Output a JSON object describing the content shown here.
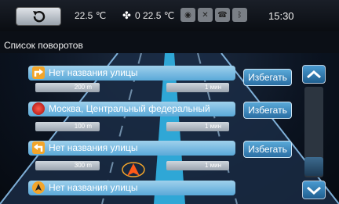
{
  "header": {
    "temp_left": "22.5 ℃",
    "temp_right": "0 22.5 ℃",
    "clock": "15:30",
    "icons": [
      "back-icon",
      "fan-icon",
      "eye-icon",
      "mute-icon",
      "phone-icon",
      "bluetooth-icon"
    ]
  },
  "page": {
    "title": "Список поворотов"
  },
  "turns": [
    {
      "street": "Нет названия улицы",
      "distance": "200 m",
      "time": "1 мин",
      "avoid_label": "Избегать",
      "icon": "turn-right-icon"
    },
    {
      "street": "Москва, Центральный федеральный",
      "distance": "100 m",
      "time": "1 мин",
      "avoid_label": "Избегать",
      "icon": "region-icon"
    },
    {
      "street": "Нет названия улицы",
      "distance": "300 m",
      "time": "1 мин",
      "avoid_label": "Избегать",
      "icon": "turn-left-icon"
    },
    {
      "street": "Нет названия улицы",
      "icon": "arrow-icon"
    }
  ],
  "colors": {
    "accent": "#5aa9d8",
    "row_bar": "#9fd0ec",
    "turn_icon": "#f2a52b"
  }
}
